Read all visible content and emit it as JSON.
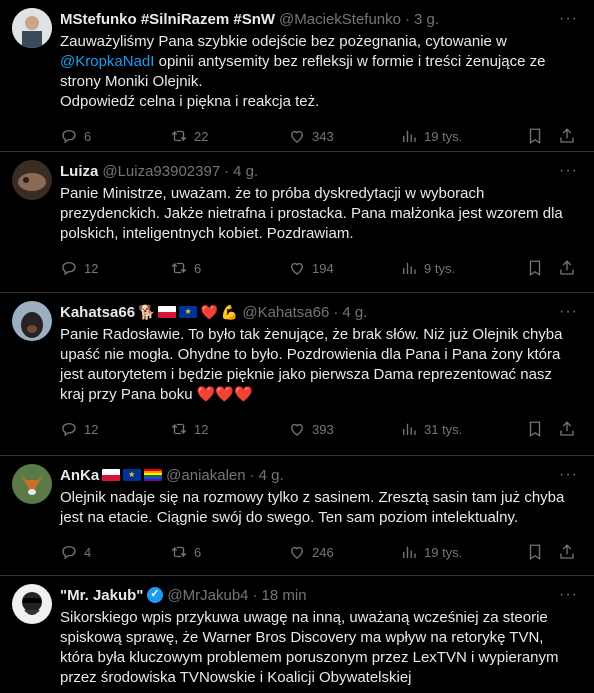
{
  "tweets": [
    {
      "name": "MStefunko #SilniRazem #SnW",
      "handle": "@MaciekStefunko",
      "time": "3 g.",
      "text_pre": "Zauważyliśmy Pana szybkie odejście bez pożegnania, cytowanie w ",
      "mention": "@KropkaNadI",
      "text_post": " opinii antysemity bez refleksji w formie i treści żenujące ze strony Moniki Olejnik.",
      "text_line2": "Odpowiedź celna i piękna i reakcja też.",
      "replies": "6",
      "retweets": "22",
      "likes": "343",
      "views": "19 tys."
    },
    {
      "name": "Luiza",
      "handle": "@Luiza93902397",
      "time": "4 g.",
      "text": "Panie Ministrze, uważam. że to próba dyskredytacji w wyborach prezydenckich. Jakże nietrafna i prostacka. Pana małżonka jest wzorem dla polskich, inteligentnych kobiet. Pozdrawiam.",
      "replies": "12",
      "retweets": "6",
      "likes": "194",
      "views": "9 tys."
    },
    {
      "name": "Kahatsa66",
      "handle": "@Kahatsa66",
      "time": "4 g.",
      "text": "Panie Radosławie. To było tak żenujące, że brak słów. Niż już Olejnik chyba upaść nie mogła. Ohydne to było. Pozdrowienia dla Pana i Pana żony która jest autorytetem i będzie pięknie jako pierwsza Dama reprezentować nasz kraj przy Pana boku ❤️❤️❤️",
      "replies": "12",
      "retweets": "12",
      "likes": "393",
      "views": "31 tys."
    },
    {
      "name": "AnKa",
      "handle": "@aniakalen",
      "time": "4 g.",
      "text": "Olejnik nadaje się na rozmowy tylko z sasinem. Zresztą sasin tam już chyba jest na etacie. Ciągnie swój do swego. Ten sam poziom intelektualny.",
      "replies": "4",
      "retweets": "6",
      "likes": "246",
      "views": "19 tys."
    },
    {
      "name": "\"Mr. Jakub\"",
      "handle": "@MrJakub4",
      "time": "18 min",
      "text": "Sikorskiego wpis przykuwa uwagę na inną, uważaną wcześniej za steorie spiskową sprawę, że Warner Bros Discovery ma wpływ na retorykę TVN, która była kluczowym problemem poruszonym przez LexTVN i wypieranym przez środowiska TVNowskie i Koalicji Obywatelskiej"
    }
  ],
  "separator": "·",
  "more": "···",
  "emoji": {
    "heart": "❤️",
    "muscle": "💪",
    "dog": "🐕"
  }
}
